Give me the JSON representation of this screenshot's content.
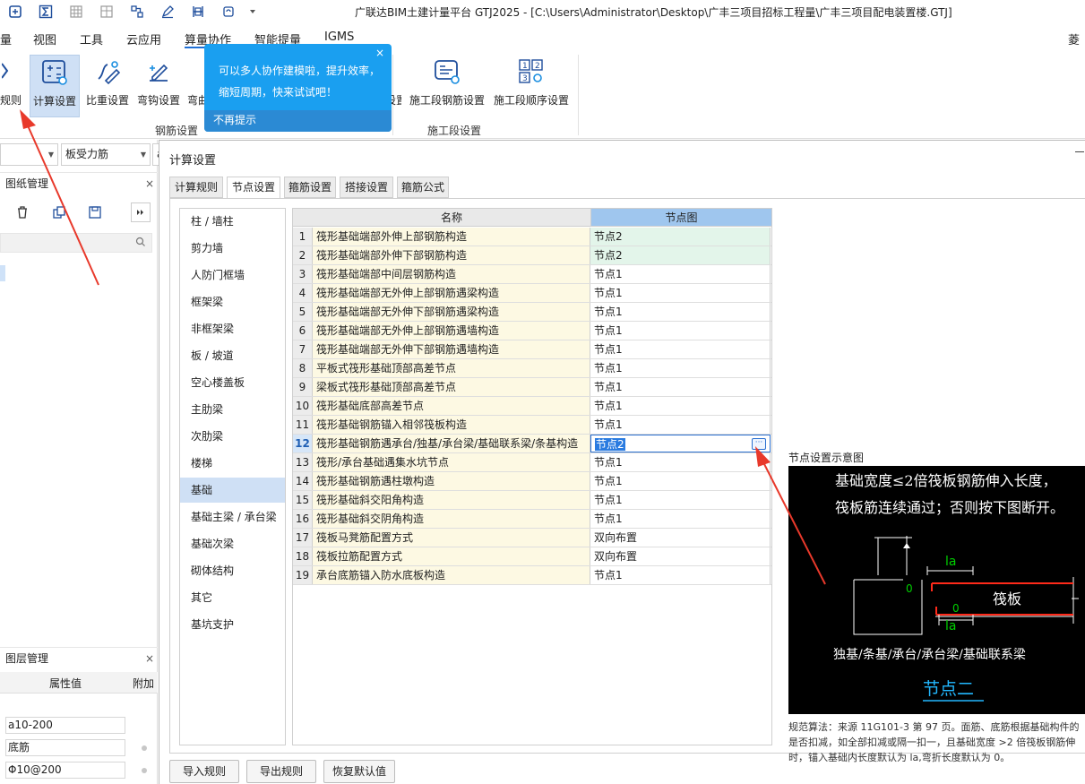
{
  "window": {
    "title": "广联达BIM土建计量平台 GTJ2025 - [C:\\Users\\Administrator\\Desktop\\广丰三项目招标工程量\\广丰三项目配电装置楼.GTJ]"
  },
  "quick_access": [
    "app-icon",
    "sum-icon",
    "grid-icon",
    "table-icon",
    "network-icon",
    "edit-icon",
    "ruler-icon",
    "refresh-icon",
    "dropdown-arrow-icon"
  ],
  "menu": [
    "量",
    "视图",
    "工具",
    "云应用",
    "算量协作",
    "智能提量",
    "IGMS",
    "菱层"
  ],
  "ribbon": {
    "buttons": [
      "规则",
      "计算设置",
      "比重设置",
      "弯钩设置",
      "弯曲",
      "量设置",
      "施工段钢筋设置",
      "施工段顺序设置"
    ],
    "groups": [
      "钢筋设置",
      "施工段设置"
    ]
  },
  "tooltip": {
    "text": "可以多人协作建模啦，提升效率，缩短周期，快来试试吧！",
    "dismiss": "不再提示",
    "close": "×"
  },
  "left": {
    "combo1": "",
    "combo2": "板受力筋",
    "combo3": "a",
    "drawing_panel_title": "图纸管理",
    "layer_panel_title": "图层管理",
    "prop_header": {
      "value": "属性值",
      "extra": "附加"
    },
    "props": [
      "a10-200",
      "底筋",
      "Φ10@200"
    ],
    "close": "×"
  },
  "dialog": {
    "title": "计算设置",
    "tabs": [
      "计算规则",
      "节点设置",
      "箍筋设置",
      "搭接设置",
      "箍筋公式"
    ],
    "active_tab": 1,
    "categories": [
      "柱 / 墙柱",
      "剪力墙",
      "人防门框墙",
      "框架梁",
      "非框架梁",
      "板 / 坡道",
      "空心楼盖板",
      "主肋梁",
      "次肋梁",
      "楼梯",
      "基础",
      "基础主梁 / 承台梁",
      "基础次梁",
      "砌体结构",
      "其它",
      "基坑支护"
    ],
    "selected_category": 10,
    "grid": {
      "headers": [
        "名称",
        "节点图"
      ],
      "rows": [
        {
          "no": "1",
          "name": "筏形基础端部外伸上部钢筋构造",
          "value": "节点2"
        },
        {
          "no": "2",
          "name": "筏形基础端部外伸下部钢筋构造",
          "value": "节点2"
        },
        {
          "no": "3",
          "name": "筏形基础端部中间层钢筋构造",
          "value": "节点1"
        },
        {
          "no": "4",
          "name": "筏形基础端部无外伸上部钢筋遇梁构造",
          "value": "节点1"
        },
        {
          "no": "5",
          "name": "筏形基础端部无外伸下部钢筋遇梁构造",
          "value": "节点1"
        },
        {
          "no": "6",
          "name": "筏形基础端部无外伸上部钢筋遇墙构造",
          "value": "节点1"
        },
        {
          "no": "7",
          "name": "筏形基础端部无外伸下部钢筋遇墙构造",
          "value": "节点1"
        },
        {
          "no": "8",
          "name": "平板式筏形基础顶部高差节点",
          "value": "节点1"
        },
        {
          "no": "9",
          "name": "梁板式筏形基础顶部高差节点",
          "value": "节点1"
        },
        {
          "no": "10",
          "name": "筏形基础底部高差节点",
          "value": "节点1"
        },
        {
          "no": "11",
          "name": "筏形基础钢筋锚入相邻筏板构造",
          "value": "节点1"
        },
        {
          "no": "12",
          "name": "筏形基础钢筋遇承台/独基/承台梁/基础联系梁/条基构造",
          "value": "节点2"
        },
        {
          "no": "13",
          "name": "筏形/承台基础遇集水坑节点",
          "value": "节点1"
        },
        {
          "no": "14",
          "name": "筏形基础钢筋遇柱墩构造",
          "value": "节点1"
        },
        {
          "no": "15",
          "name": "筏形基础斜交阳角构造",
          "value": "节点1"
        },
        {
          "no": "16",
          "name": "筏形基础斜交阴角构造",
          "value": "节点1"
        },
        {
          "no": "17",
          "name": "筏板马凳筋配置方式",
          "value": "双向布置"
        },
        {
          "no": "18",
          "name": "筏板拉筋配置方式",
          "value": "双向布置"
        },
        {
          "no": "19",
          "name": "承台底筋锚入防水底板构造",
          "value": "节点1"
        }
      ],
      "selected_row": 11,
      "ellipsis": "···"
    },
    "diagram": {
      "title": "节点设置示意图",
      "line1": "基础宽度≤2倍筏板钢筋伸入长度，",
      "line2": "筏板筋连续通过；否则按下图断开。",
      "label_la_top": "la",
      "label_la_bottom": "la",
      "label_zero1": "0",
      "label_zero2": "0",
      "label_slab": "筏板",
      "label_members": "独基/条基/承台/承台梁/基础联系梁",
      "caption": "节点二",
      "desc1": "规范算法：来源 11G101-3 第 97 页。面筋、底筋根据基础构件的",
      "desc2": "是否扣减，如全部扣减或隔一扣一，且基础宽度 >2 倍筏板钢筋伸",
      "desc3": "时，锚入基础内长度默认为 la,弯折长度默认为 0。"
    },
    "buttons": [
      "导入规则",
      "导出规则",
      "恢复默认值"
    ]
  },
  "colors": {
    "accent": "#1f6fd6",
    "tooltip": "#1a9ff0",
    "annotation_arrow": "#e8392b",
    "header_node": "#9fc6ee",
    "diagram_text": "#ffffff",
    "diagram_red": "#ff2a1a",
    "diagram_green": "#00d000"
  }
}
